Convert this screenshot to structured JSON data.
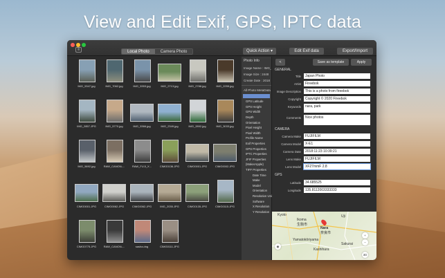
{
  "headline": "View and Edit Exif, GPS, IPTC data",
  "toolbar": {
    "sidebar_toggle": "≡",
    "tabs": [
      "Local Photo",
      "Camera Photo"
    ],
    "quick_action": "Quick Action ▾",
    "edit_exif": "Edit Exif data",
    "export_import": "Export/Import"
  },
  "photos": [
    {
      "name": "IMG_5347.jpg",
      "wide": false,
      "colors": [
        "#87a0b4",
        "#5a5f55"
      ]
    },
    {
      "name": "IMG_7062.jpg",
      "wide": false,
      "colors": [
        "#4f6770",
        "#8d8e7c"
      ]
    },
    {
      "name": "IMG_5353.jpg",
      "wide": false,
      "colors": [
        "#7a93aa",
        "#484848"
      ]
    },
    {
      "name": "IMG_2713.jpg",
      "wide": true,
      "colors": [
        "#6b8a5a",
        "#c4c2a6"
      ]
    },
    {
      "name": "IMG_2788.jpg",
      "wide": false,
      "colors": [
        "#c8c8c0",
        "#6e6e6a"
      ]
    },
    {
      "name": "IMG_2255.jpg",
      "wide": false,
      "colors": [
        "#4a3a2a",
        "#c9c2b0"
      ]
    },
    {
      "name": "IMG_2857.JPG",
      "wide": false,
      "colors": [
        "#a4b6c2",
        "#3e4a3e"
      ]
    },
    {
      "name": "IMG_5770.jpg",
      "wide": false,
      "colors": [
        "#c6a98a",
        "#6c6c6c"
      ]
    },
    {
      "name": "IMG_5366.jpg",
      "wide": true,
      "colors": [
        "#b0b8c0",
        "#506070"
      ]
    },
    {
      "name": "IMG_2349.jpg",
      "wide": true,
      "colors": [
        "#8fb0d0",
        "#3d6a3d"
      ]
    },
    {
      "name": "IMG_2892.jpg",
      "wide": false,
      "colors": [
        "#d2d5d8",
        "#2f6a3a"
      ]
    },
    {
      "name": "IMG_3033.jpg",
      "wide": false,
      "colors": [
        "#a9885b",
        "#3c3c3c"
      ]
    },
    {
      "name": "IMG_5692.jpg",
      "wide": false,
      "colors": [
        "#59606a",
        "#c0c4c6"
      ]
    },
    {
      "name": "RAW_CANON-...",
      "wide": false,
      "colors": [
        "#7c6f62",
        "#d6c9b4"
      ]
    },
    {
      "name": "RAW_FUJI_X...",
      "wide": false,
      "colors": [
        "#8c8c8c",
        "#3d3d3d"
      ]
    },
    {
      "name": "CIMG0136.JPG",
      "wide": false,
      "colors": [
        "#8aa05a",
        "#5d4c3a"
      ]
    },
    {
      "name": "CIMG0001.JPG",
      "wide": true,
      "colors": [
        "#c0b9a7",
        "#495055"
      ]
    },
    {
      "name": "CIMG0002.JPG",
      "wide": true,
      "colors": [
        "#7d7e6e",
        "#4c5a6a"
      ]
    },
    {
      "name": "CIMG0001.JPG",
      "wide": true,
      "colors": [
        "#91a8c0",
        "#4c6d4c"
      ]
    },
    {
      "name": "CIMG0062.JPG",
      "wide": true,
      "colors": [
        "#d0d0cc",
        "#5c5c58"
      ]
    },
    {
      "name": "CIMG0062.JPG",
      "wide": true,
      "colors": [
        "#aab4bc",
        "#3e4042"
      ]
    },
    {
      "name": "IMG_2035.JPG",
      "wide": true,
      "colors": [
        "#b5aa95",
        "#6a5e4b"
      ]
    },
    {
      "name": "CIMG0135.JPG",
      "wide": true,
      "colors": [
        "#8ca07a",
        "#4a4a42"
      ]
    },
    {
      "name": "CIMG0115.JPG",
      "wide": false,
      "colors": [
        "#a7b7c6",
        "#546a4c"
      ]
    },
    {
      "name": "CIMG0775.JPG",
      "wide": false,
      "colors": [
        "#7c8c6c",
        "#3c3f37"
      ]
    },
    {
      "name": "RAW_CANON-...",
      "wide": false,
      "colors": [
        "#3a3a3a",
        "#8c8c8c"
      ]
    },
    {
      "name": "sasha.dng",
      "wide": false,
      "colors": [
        "#c08878",
        "#5a6a8a"
      ]
    },
    {
      "name": "CIMG0111.JPG",
      "wide": false,
      "colors": [
        "#9a8f84",
        "#4a4038"
      ]
    }
  ],
  "inspector": {
    "title": "Photo Info",
    "name_row": "Image Name : IMG_5",
    "size_row": "Image Size : 2448",
    "date_row": "Create Date : 2018",
    "meta_title": "All Photo MetaData",
    "items": [
      "GPS Latitude",
      "GPS Height",
      "GPS Width",
      "Depth",
      "Orientation",
      "Pixel Height",
      "Pixel Width",
      "Profile Name",
      "Exif Properties",
      "GPS Properties",
      "IPTC Properties",
      "JFIF Properties",
      "{MakerApple}",
      "TIFF Properties"
    ],
    "sub_items": [
      "Date Time",
      "Make",
      "Model",
      "Orientation",
      "Resolution Unit",
      "Software",
      "X Resolution",
      "Y Resolution"
    ]
  },
  "panel": {
    "back": "<",
    "save_template": "Save as template",
    "apply": "Apply",
    "general_title": "GENERAL",
    "camera_title": "CAMERA",
    "gps_title": "GPS",
    "fields": {
      "title": {
        "label": "Title",
        "value": "Japan Photo"
      },
      "artist": {
        "label": "Artist",
        "value": "Fireebok"
      },
      "description": {
        "label": "Image Description",
        "value": "This is a photo from fireebok"
      },
      "copyright": {
        "label": "Copyright",
        "value": "Copyright © 2020 Fireebok"
      },
      "keywords": {
        "label": "Keywords",
        "value": "nara, park"
      },
      "comments": {
        "label": "Comments",
        "value": "Nice photos"
      },
      "make": {
        "label": "Camera Make",
        "value": "FUJIFILM"
      },
      "model": {
        "label": "Camera Model",
        "value": "X-E1"
      },
      "date": {
        "label": "Camera Date",
        "value": "2018:11:23 10:39:21"
      },
      "lens_make": {
        "label": "Lens Make",
        "value": "FUJIFILM"
      },
      "lens_model": {
        "label": "Lens Model",
        "value": "XF27mmF 2.8"
      },
      "latitude": {
        "label": "Latitude",
        "value": "34.685525"
      },
      "longitude": {
        "label": "Longitude",
        "value": "135.8112003333333"
      }
    },
    "map": {
      "labels": [
        "Ikoma",
        "生駒市",
        "Nara",
        "奈良市",
        "Kyoto",
        "Uji",
        "Sakurai",
        "Kashihara",
        "Yamatokōriyama"
      ],
      "btn_3d": "3D",
      "btn_zoom_in": "+",
      "btn_zoom_out": "−"
    }
  }
}
